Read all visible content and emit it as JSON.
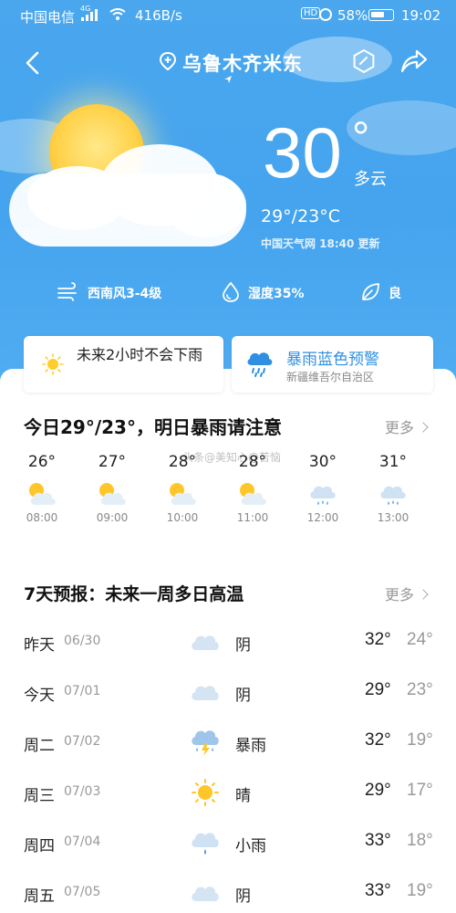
{
  "status_bar": {
    "carrier": "中国电信",
    "network": "4G",
    "speed": "416B/s",
    "hd": "HD",
    "battery": "58%",
    "time": "19:02"
  },
  "header": {
    "city": "乌鲁木齐米东"
  },
  "current": {
    "temp": "30",
    "degree": "°",
    "condition": "多云",
    "hi_lo": "29°/23°C",
    "source": "中国天气网 18:40 更新"
  },
  "stats": [
    {
      "icon": "wind-icon",
      "label": "西南风3-4级"
    },
    {
      "icon": "humidity-icon",
      "label": "湿度35%"
    },
    {
      "icon": "leaf-icon",
      "label": "良"
    }
  ],
  "cards": {
    "rain_forecast": "未来2小时不会下雨",
    "warning_title": "暴雨蓝色预警",
    "warning_region": "新疆维吾尔自治区"
  },
  "today": {
    "title": "今日29°/23°，明日暴雨请注意",
    "more": "更多",
    "watermark": "头条@美知心@苦恼",
    "hours": [
      {
        "temp": "26°",
        "time": "08:00",
        "icon": "partly-cloudy-icon"
      },
      {
        "temp": "27°",
        "time": "09:00",
        "icon": "partly-cloudy-icon"
      },
      {
        "temp": "28°",
        "time": "10:00",
        "icon": "partly-cloudy-icon"
      },
      {
        "temp": "28°",
        "time": "11:00",
        "icon": "partly-cloudy-icon"
      },
      {
        "temp": "30°",
        "time": "12:00",
        "icon": "rain-icon"
      },
      {
        "temp": "31°",
        "time": "13:00",
        "icon": "rain-icon"
      }
    ]
  },
  "week": {
    "title": "7天预报：未来一周多日高温",
    "more": "更多",
    "days": [
      {
        "day": "昨天",
        "date": "06/30",
        "cond": "阴",
        "hi": "32°",
        "lo": "24°",
        "icon": "cloud-icon"
      },
      {
        "day": "今天",
        "date": "07/01",
        "cond": "阴",
        "hi": "29°",
        "lo": "23°",
        "icon": "cloud-icon"
      },
      {
        "day": "周二",
        "date": "07/02",
        "cond": "暴雨",
        "hi": "32°",
        "lo": "19°",
        "icon": "storm-icon"
      },
      {
        "day": "周三",
        "date": "07/03",
        "cond": "晴",
        "hi": "29°",
        "lo": "17°",
        "icon": "sun-icon"
      },
      {
        "day": "周四",
        "date": "07/04",
        "cond": "小雨",
        "hi": "33°",
        "lo": "18°",
        "icon": "light-rain-icon"
      },
      {
        "day": "周五",
        "date": "07/05",
        "cond": "阴",
        "hi": "33°",
        "lo": "19°",
        "icon": "cloud-icon"
      }
    ]
  },
  "colors": {
    "sky": "#4aa7ee",
    "accent_blue": "#2f8fe3",
    "sun": "#ffd24a"
  }
}
